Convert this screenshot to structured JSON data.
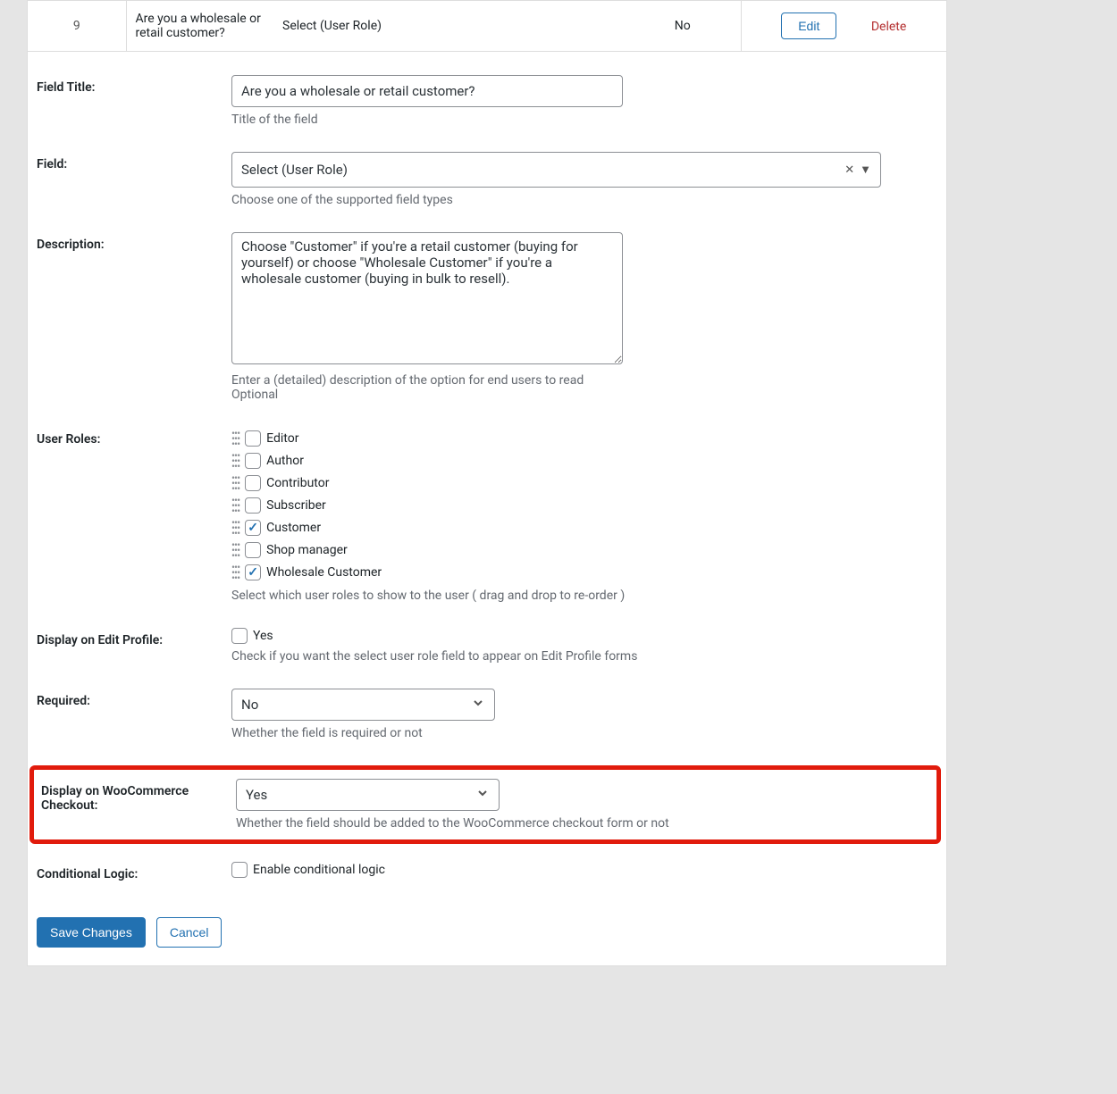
{
  "header": {
    "num": "9",
    "title": "Are you a wholesale or retail customer?",
    "type": "Select (User Role)",
    "required": "No",
    "edit": "Edit",
    "delete": "Delete"
  },
  "labels": {
    "field_title": "Field Title:",
    "field": "Field:",
    "description": "Description:",
    "user_roles": "User Roles:",
    "display_edit": "Display on Edit Profile:",
    "required": "Required:",
    "display_woo": "Display on WooCommerce Checkout:",
    "conditional": "Conditional Logic:"
  },
  "values": {
    "field_title": "Are you a wholesale or retail customer?",
    "field_type": "Select (User Role)",
    "description": "Choose \"Customer\" if you're a retail customer (buying for yourself) or choose \"Wholesale Customer\" if you're a wholesale customer (buying in bulk to resell).",
    "required": "No",
    "display_woo": "Yes"
  },
  "help": {
    "field_title": "Title of the field",
    "field_type": "Choose one of the supported field types",
    "desc1": "Enter a (detailed) description of the option for end users to read",
    "desc2": "Optional",
    "roles": "Select which user roles to show to the user ( drag and drop to re-order )",
    "display_edit": "Check if you want the select user role field to appear on Edit Profile forms",
    "required": "Whether the field is required or not",
    "display_woo": "Whether the field should be added to the WooCommerce checkout form or not"
  },
  "roles": [
    {
      "label": "Editor",
      "checked": false
    },
    {
      "label": "Author",
      "checked": false
    },
    {
      "label": "Contributor",
      "checked": false
    },
    {
      "label": "Subscriber",
      "checked": false
    },
    {
      "label": "Customer",
      "checked": true
    },
    {
      "label": "Shop manager",
      "checked": false
    },
    {
      "label": "Wholesale Customer",
      "checked": true
    }
  ],
  "checkboxes": {
    "display_edit_label": "Yes",
    "conditional_label": "Enable conditional logic"
  },
  "buttons": {
    "save": "Save Changes",
    "cancel": "Cancel"
  }
}
